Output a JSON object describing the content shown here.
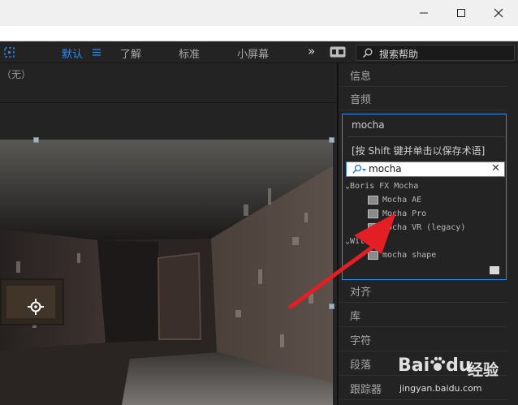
{
  "toolbar": {
    "workspaces": [
      "默认",
      "了解",
      "标准",
      "小屏幕"
    ],
    "overflow": "»",
    "search_help_placeholder": "搜索帮助"
  },
  "viewer": {
    "top_label": "（无）"
  },
  "panels": {
    "info": "信息",
    "audio": "音频",
    "align": "对齐",
    "library": "库",
    "character": "字符",
    "paragraph": "段落",
    "tracker": "跟踪器"
  },
  "effects": {
    "title": "mocha",
    "hint": "[按 Shift 键并单击以保存术语]",
    "search_value": "mocha",
    "clear": "✕",
    "groups": [
      {
        "name": "Boris FX Mocha",
        "items": [
          "Mocha AE",
          "Mocha Pro",
          "Mocha VR (legacy)"
        ]
      },
      {
        "name": "Witte",
        "items": [
          "mocha shape"
        ]
      }
    ]
  },
  "watermark": {
    "brand": "Bai",
    "brand_suffix": "du",
    "zh": "经验",
    "url": "jingyan.baidu.com"
  },
  "colors": {
    "accent": "#2d8ceb",
    "arrow": "#e41e25"
  }
}
